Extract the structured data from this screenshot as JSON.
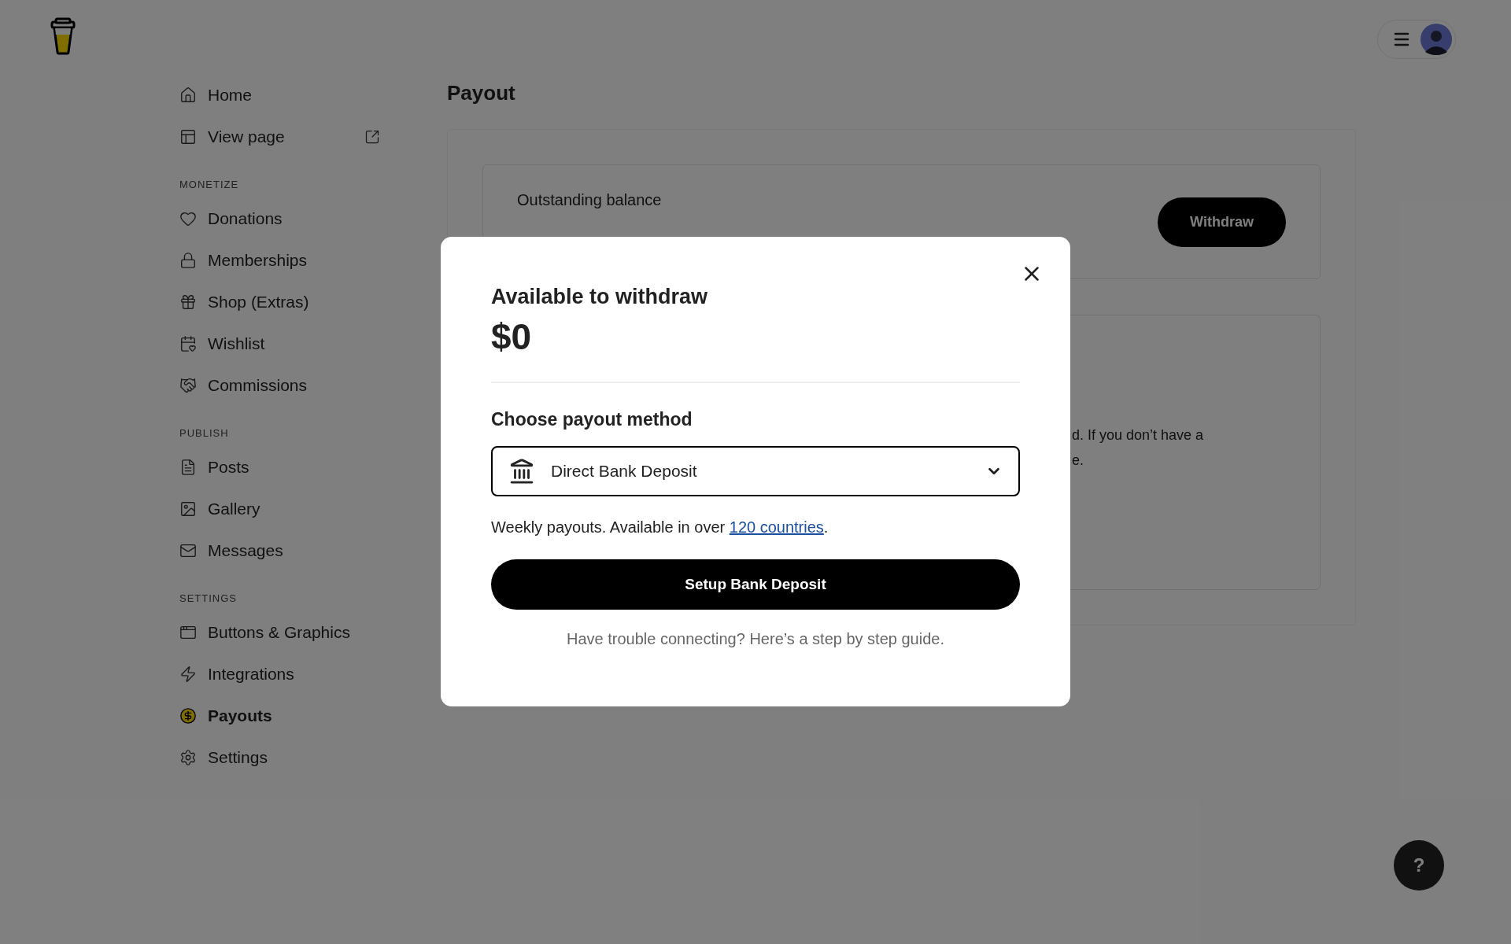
{
  "sidebar": {
    "top_items": [
      {
        "label": "Home",
        "selected": false,
        "kind": "link"
      },
      {
        "label": "View page",
        "selected": false,
        "kind": "external"
      }
    ],
    "sections": [
      {
        "heading": "MONETIZE",
        "items": [
          {
            "label": "Donations",
            "selected": false
          },
          {
            "label": "Memberships",
            "selected": false
          },
          {
            "label": "Shop (Extras)",
            "selected": false
          },
          {
            "label": "Wishlist",
            "selected": false
          },
          {
            "label": "Commissions",
            "selected": false
          }
        ]
      },
      {
        "heading": "PUBLISH",
        "items": [
          {
            "label": "Posts",
            "selected": false
          },
          {
            "label": "Gallery",
            "selected": false
          },
          {
            "label": "Messages",
            "selected": false
          }
        ]
      },
      {
        "heading": "SETTINGS",
        "items": [
          {
            "label": "Buttons & Graphics",
            "selected": false
          },
          {
            "label": "Integrations",
            "selected": false
          },
          {
            "label": "Payouts",
            "selected": true
          },
          {
            "label": "Settings",
            "selected": false
          }
        ]
      }
    ]
  },
  "page_title": "Payout",
  "balance_card": {
    "label": "Outstanding balance",
    "button": "Withdraw"
  },
  "info_card": {
    "lines": [
      "d. If you don’t have a",
      "e."
    ]
  },
  "modal": {
    "title": "Available to withdraw",
    "amount": "$0",
    "method_heading": "Choose payout method",
    "method": "Direct Bank Deposit",
    "note": "Weekly payouts. Available in over ",
    "note_link": "120 countries",
    "note_end": ".",
    "button": "Setup Bank Deposit",
    "guide": "Have trouble connecting? Here’s a step by step guide."
  },
  "help_button": "?"
}
